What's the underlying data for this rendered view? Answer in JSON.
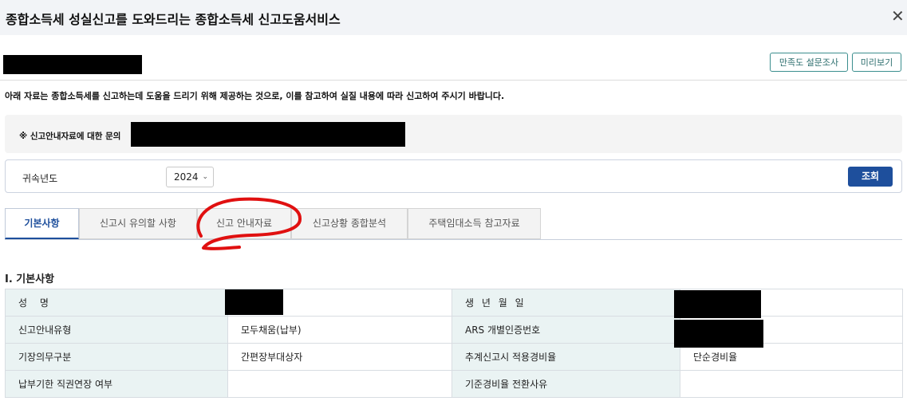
{
  "window": {
    "title": "종합소득세 성실신고를 도와드리는 종합소득세 신고도움서비스",
    "close_icon": "close-icon"
  },
  "toolbar": {
    "survey_label": "만족도 설문조사",
    "preview_label": "미리보기"
  },
  "notice": "아래 자료는 종합소득세를 신고하는데 도움을 드리기 위해 제공하는 것으로, 이를 참고하여 실질 내용에 따라 신고하여 주시기 바랍니다.",
  "inquiry": {
    "label": "※ 신고안내자료에 대한 문의"
  },
  "year_filter": {
    "label": "귀속년도",
    "selected": "2024",
    "search_label": "조회"
  },
  "tabs": [
    {
      "label": "기본사항",
      "active": true
    },
    {
      "label": "신고시 유의할 사항",
      "active": false
    },
    {
      "label": "신고 안내자료",
      "active": false
    },
    {
      "label": "신고상황 종합분석",
      "active": false
    },
    {
      "label": "주택임대소득 참고자료",
      "active": false
    }
  ],
  "annotation": {
    "color": "#e01010"
  },
  "section": {
    "title": "Ⅰ. 기본사항",
    "rows": [
      {
        "label1": "성     명",
        "value1": "",
        "label2": "생 년 월 일",
        "value2": ""
      },
      {
        "label1": "신고안내유형",
        "value1": "모두채움(납부)",
        "label2": "ARS 개별인증번호",
        "value2": ""
      },
      {
        "label1": "기장의무구분",
        "value1": "간편장부대상자",
        "label2": "추계신고시 적용경비율",
        "value2": "단순경비율"
      },
      {
        "label1": "납부기한 직권연장 여부",
        "value1": "",
        "label2": "기준경비율 전환사유",
        "value2": ""
      }
    ]
  },
  "colors": {
    "accent": "#1e4f9c",
    "label_bg": "#eaf3f3",
    "button_border": "#3b8e8e"
  }
}
